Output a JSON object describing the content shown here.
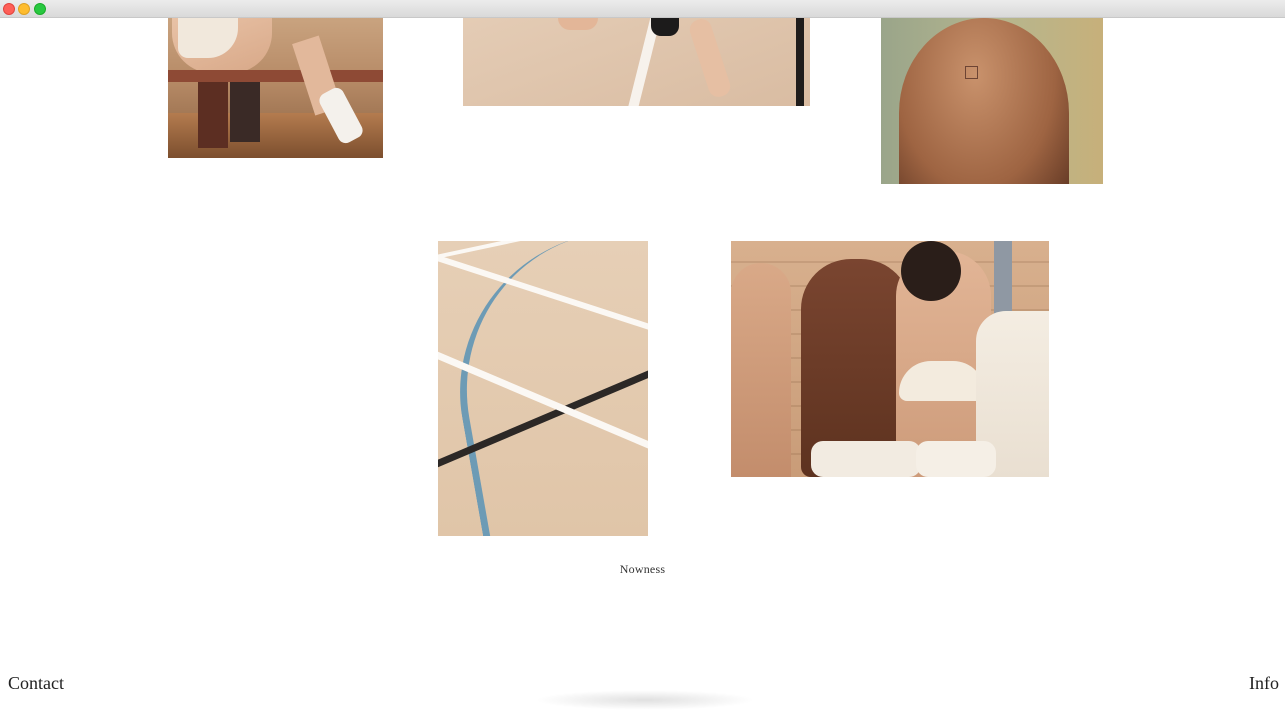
{
  "window": {
    "controls": [
      "close",
      "minimize",
      "maximize"
    ],
    "control_colors": [
      "#fe5f57",
      "#febc2e",
      "#28c840"
    ]
  },
  "gallery": {
    "photos": [
      {
        "subject": "bench-legs"
      },
      {
        "subject": "seated-legs-court"
      },
      {
        "subject": "back-of-neck"
      },
      {
        "subject": "court-floor-lines"
      },
      {
        "subject": "group-seated"
      }
    ],
    "caption": "Nowness"
  },
  "footer": {
    "contact_label": "Contact",
    "info_label": "Info"
  }
}
